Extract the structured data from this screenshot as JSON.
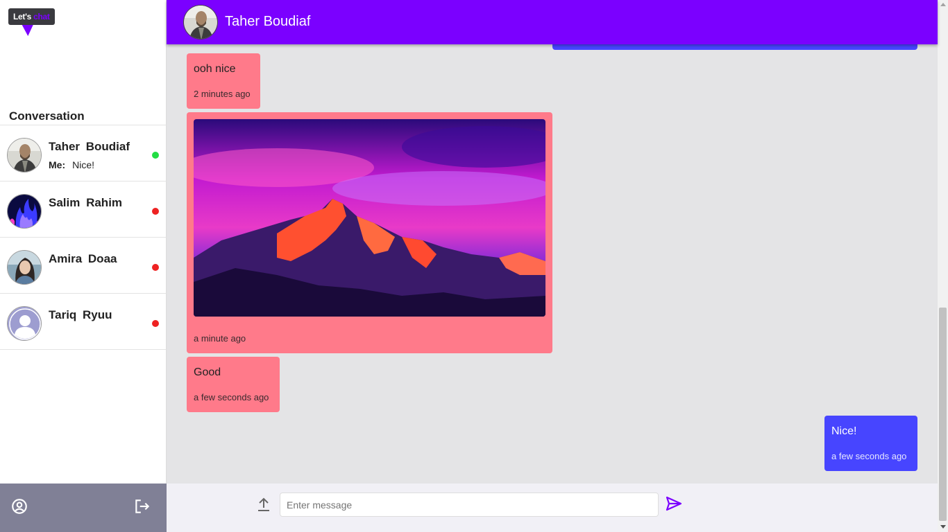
{
  "logo": {
    "text_main": "Let's",
    "text_accent": "chat"
  },
  "sidebar": {
    "title": "Conversation",
    "conversations": [
      {
        "name": "Taher  Boudiaf",
        "last_prefix": "Me:",
        "last_message": "Nice!",
        "status": "online",
        "status_color": "#22dd44"
      },
      {
        "name": "Salim  Rahim",
        "last_prefix": "",
        "last_message": "",
        "status": "offline",
        "status_color": "#ee2222"
      },
      {
        "name": "Amira  Doaa",
        "last_prefix": "",
        "last_message": "",
        "status": "offline",
        "status_color": "#ee2222"
      },
      {
        "name": "Tariq  Ryuu",
        "last_prefix": "",
        "last_message": "",
        "status": "offline",
        "status_color": "#ee2222"
      }
    ],
    "footer": {
      "profile_icon": "user-circle-icon",
      "logout_icon": "logout-icon"
    }
  },
  "header": {
    "name": "Taher Boudiaf"
  },
  "messages": [
    {
      "direction": "in",
      "text": "ooh nice",
      "time": "2 minutes ago"
    },
    {
      "direction": "in",
      "type": "image",
      "image": "mountain-sunset-photo",
      "time": "a minute ago"
    },
    {
      "direction": "in",
      "text": "Good",
      "time": "a few seconds ago"
    },
    {
      "direction": "out",
      "text": "Nice!",
      "time": "a few seconds ago"
    }
  ],
  "composer": {
    "placeholder": "Enter message",
    "value": "",
    "upload_icon": "upload-icon",
    "send_icon": "send-icon"
  },
  "colors": {
    "brand": "#7b00ff",
    "incoming": "#ff7a8a",
    "outgoing": "#4745ff",
    "sidebar_footer": "#808096"
  }
}
